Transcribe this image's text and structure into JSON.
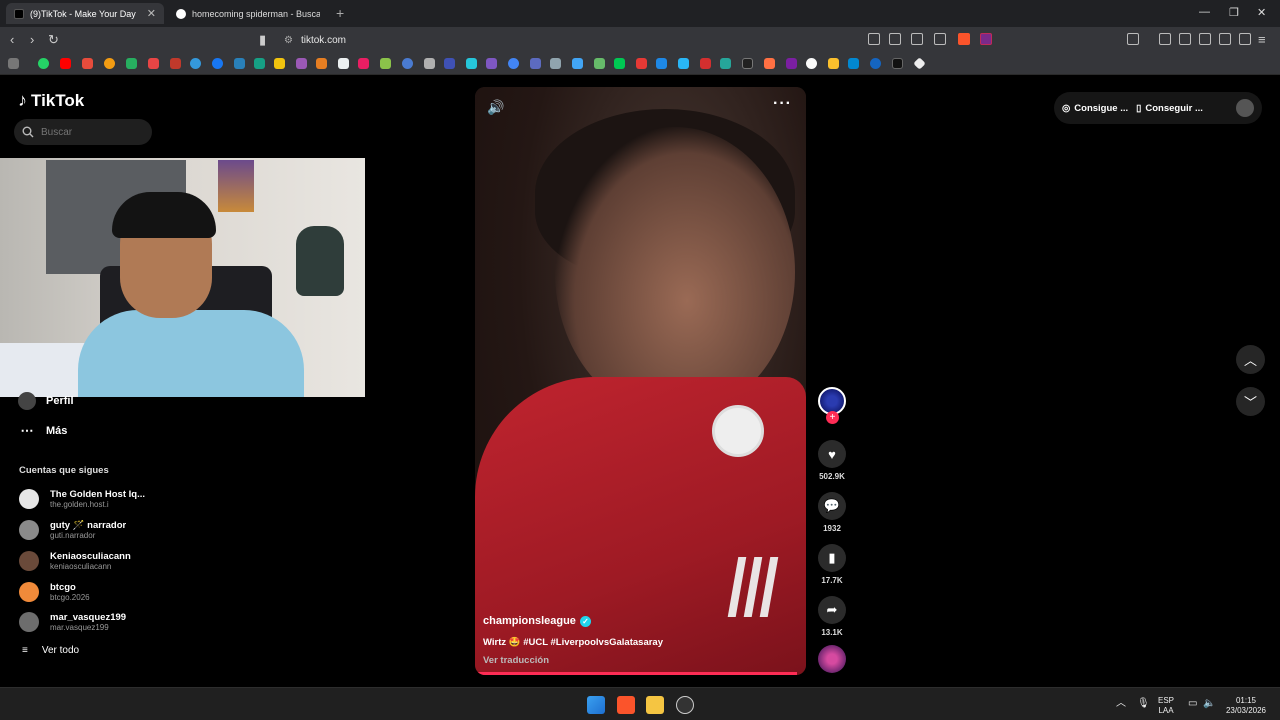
{
  "browser": {
    "tabs": [
      {
        "title": "(9)TikTok - Make Your Day",
        "active": true
      },
      {
        "title": "homecoming spiderman - Buscar co",
        "active": false
      }
    ],
    "url": "tiktok.com"
  },
  "sidebar": {
    "logo": "TikTok",
    "search_placeholder": "Buscar",
    "nav": [
      {
        "label": "Perfil",
        "icon": "profile-icon"
      },
      {
        "label": "Más",
        "icon": "more-icon"
      }
    ],
    "following_title": "Cuentas que sigues",
    "accounts": [
      {
        "name": "The Golden Host Iq...",
        "handle": "the.golden.host.i",
        "color": "#e6e6e6"
      },
      {
        "name": "guty 🪄 narrador",
        "handle": "guti.narrador",
        "color": "#8a8a8a"
      },
      {
        "name": "Keniaosculiacann",
        "handle": "keniaosculiacann",
        "color": "#6a4a3a"
      },
      {
        "name": "btcgo",
        "handle": "btcgo.2026",
        "color": "#f08a3a"
      },
      {
        "name": "mar_vasquez199",
        "handle": "mar.vasquez199",
        "color": "#6d6d6d"
      }
    ],
    "see_all": "Ver todo"
  },
  "video": {
    "author": "championsleague",
    "caption": "Wirtz 🤩 #UCL #LiverpoolvsGalatasaray",
    "translate": "Ver traducción",
    "progress": 0.98
  },
  "actions": {
    "likes": "502.9K",
    "comments": "1932",
    "saves": "17.7K",
    "shares": "13.1K"
  },
  "header": {
    "coins_label": "Consigue ...",
    "app_label": "Conseguir ..."
  },
  "taskbar": {
    "lang_top": "ESP",
    "lang_bottom": "LAA",
    "time": "01:15",
    "date": "23/03/2026"
  },
  "colors": {
    "accent": "#fe2c55",
    "verified": "#20d5ec",
    "background": "#000000"
  }
}
